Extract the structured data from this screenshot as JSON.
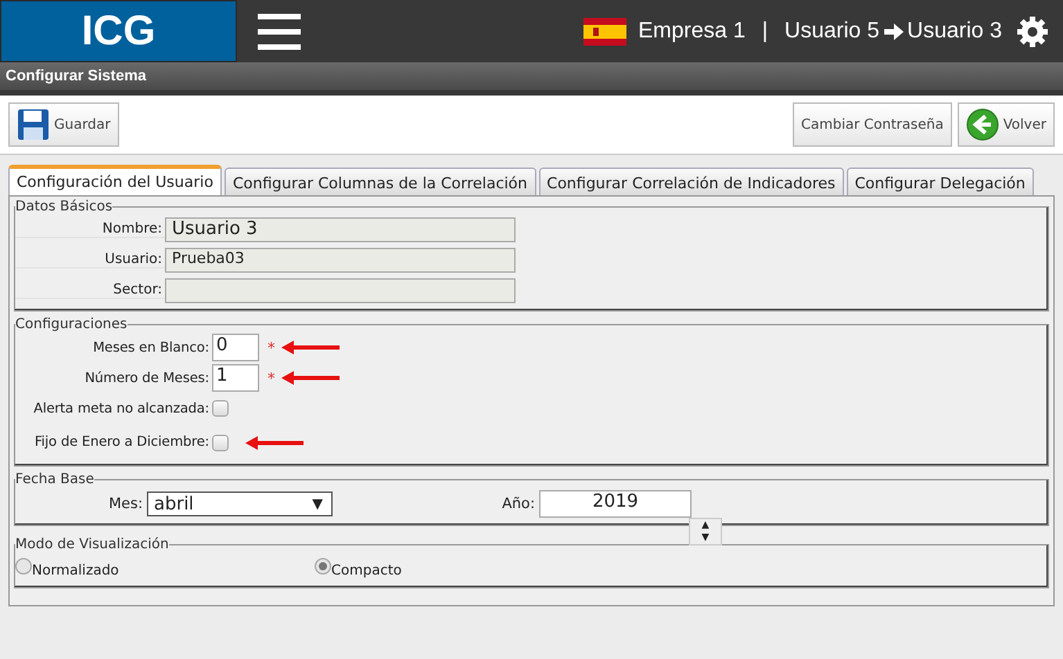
{
  "header": {
    "logo": "ICG",
    "company": "Empresa 1",
    "separator": "|",
    "user_from": "Usuario 5",
    "user_to": "Usuario 3"
  },
  "title": "Configurar Sistema",
  "toolbar": {
    "left": [
      {
        "label": "Guardar",
        "kind": "save"
      }
    ],
    "right": [
      {
        "label": "Cambiar Contraseña",
        "kind": "plain"
      },
      {
        "label": "Volver",
        "kind": "back"
      }
    ]
  },
  "tabs": [
    {
      "label": "Configuración del Usuario",
      "selected": true
    },
    {
      "label": "Configurar Columnas de la Correlación",
      "selected": false
    },
    {
      "label": "Configurar Correlación de Indicadores",
      "selected": false
    },
    {
      "label": "Configurar Delegación",
      "selected": false
    }
  ],
  "datos_basicos": {
    "legend": "Datos Básicos",
    "fields": [
      {
        "label": "Nombre:",
        "value": "Usuario 3",
        "kind": "large"
      },
      {
        "label": "Usuario:",
        "value": "Prueba03",
        "kind": "normal"
      },
      {
        "label": "Sector:",
        "kind": "normal"
      }
    ]
  },
  "configuraciones": {
    "legend": "Configuraciones",
    "rows": [
      {
        "kind": "number",
        "label": "Meses en Blanco:",
        "value": "0",
        "required_mark": "*",
        "arrow": true
      },
      {
        "kind": "number",
        "label": "Número de Meses:",
        "value": "1",
        "required_mark": "*",
        "arrow": true
      },
      {
        "kind": "checkbox",
        "label": "Alerta meta no alcanzada:",
        "checked": false,
        "arrow": false
      },
      {
        "kind": "checkbox",
        "label": "Fijo de Enero a Diciembre:",
        "checked": false,
        "arrow": true
      }
    ]
  },
  "fecha_base": {
    "legend": "Fecha Base",
    "month_label": "Mes:",
    "month": "abril",
    "month_caret": "▼",
    "year_label": "Año:",
    "year": "2019",
    "spin_up": "▲",
    "spin_down": "▼"
  },
  "modo": {
    "legend": "Modo de Visualización",
    "options": [
      {
        "label": "Normalizado",
        "selected": false
      },
      {
        "label": "Compacto",
        "selected": true
      }
    ]
  }
}
